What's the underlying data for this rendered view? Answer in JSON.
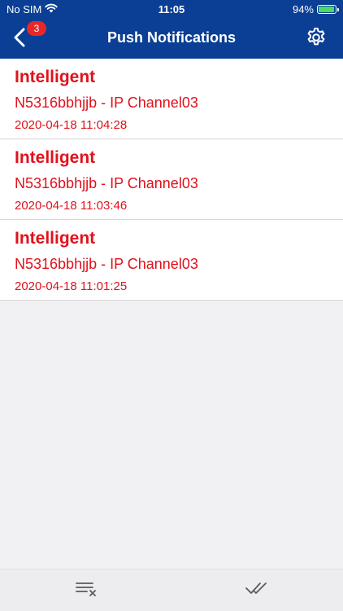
{
  "status": {
    "carrier": "No SIM",
    "time": "11:05",
    "battery_percent": "94%",
    "battery_level": 0.94
  },
  "header": {
    "title": "Push Notifications",
    "back_badge": "3",
    "back_icon": "chevron-left-icon",
    "settings_icon": "gear-icon"
  },
  "notifications": [
    {
      "title": "Intelligent",
      "source": "N5316bbhjjb - IP Channel03",
      "time": "2020-04-18 11:04:28"
    },
    {
      "title": "Intelligent",
      "source": "N5316bbhjjb - IP Channel03",
      "time": "2020-04-18 11:03:46"
    },
    {
      "title": "Intelligent",
      "source": "N5316bbhjjb - IP Channel03",
      "time": "2020-04-18 11:01:25"
    }
  ],
  "toolbar": {
    "clear_icon": "clear-list-icon",
    "read_icon": "double-check-icon"
  },
  "colors": {
    "header_bg": "#0a3f95",
    "alert_text": "#e0121c",
    "badge_bg": "#e8272a",
    "battery_fill": "#4cd964"
  }
}
